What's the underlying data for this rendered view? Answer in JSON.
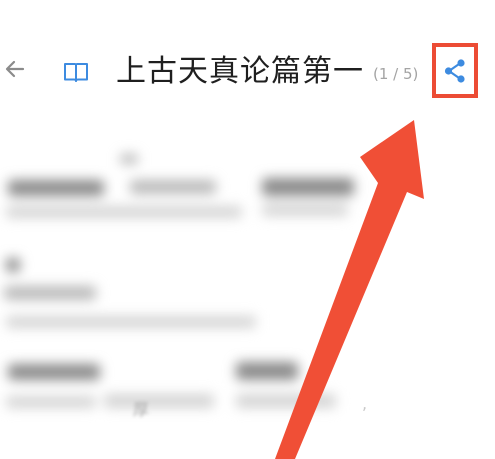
{
  "header": {
    "back_icon": "arrow-left-icon",
    "book_icon": "open-book-icon",
    "title": "上古天真论篇第一",
    "page_count": "(1 / 5)",
    "share_icon": "share-icon"
  },
  "content": {
    "blurred_fragment": "厚",
    "punctuation": ","
  },
  "colors": {
    "accent_blue": "#3d8be0",
    "highlight_red": "#ec4c35",
    "title_text": "#1f1f1f",
    "muted_text": "#a4a4a4"
  }
}
